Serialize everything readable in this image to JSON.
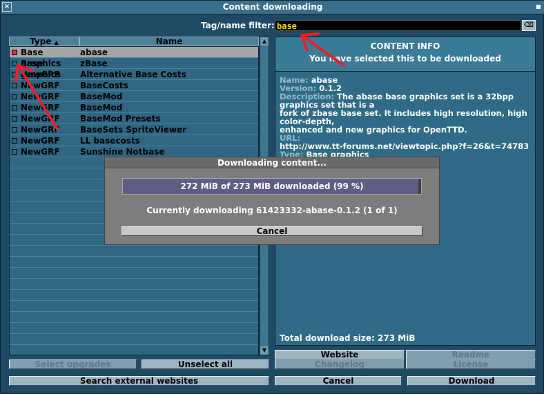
{
  "window": {
    "title": "Content downloading"
  },
  "filter": {
    "label": "Tag/name filter:",
    "value": "base",
    "clear_icon": "⌫"
  },
  "list": {
    "columns": {
      "type": "Type",
      "name": "Name"
    },
    "rows": [
      {
        "type": "Base graphics",
        "name": "abase",
        "checked": true,
        "selected": true
      },
      {
        "type": "Base graphics",
        "name": "zBase",
        "checked": false,
        "selected": false
      },
      {
        "type": "NewGRF",
        "name": "Alternative Base Costs",
        "checked": false,
        "selected": false
      },
      {
        "type": "NewGRF",
        "name": "BaseCosts",
        "checked": false,
        "selected": false
      },
      {
        "type": "NewGRF",
        "name": "BaseMod",
        "checked": false,
        "selected": false
      },
      {
        "type": "NewGRF",
        "name": "BaseMod",
        "checked": false,
        "selected": false
      },
      {
        "type": "NewGRF",
        "name": "BaseMod Presets",
        "checked": false,
        "selected": false
      },
      {
        "type": "NewGRF",
        "name": "BaseSets SpriteViewer",
        "checked": false,
        "selected": false
      },
      {
        "type": "NewGRF",
        "name": "LL basecosts",
        "checked": false,
        "selected": false
      },
      {
        "type": "NewGRF",
        "name": "Sunshine Notbase",
        "checked": false,
        "selected": false
      }
    ]
  },
  "buttons": {
    "select_upgrades": "Select upgrades",
    "unselect_all": "Unselect all",
    "search_external": "Search external websites",
    "website": "Website",
    "readme": "Readme",
    "changelog": "Changelog",
    "license": "License",
    "cancel": "Cancel",
    "download": "Download"
  },
  "info": {
    "heading": "CONTENT INFO",
    "status": "You have selected this to be downloaded",
    "name_key": "Name:",
    "name_val": "abase",
    "version_key": "Version:",
    "version_val": "0.1.2",
    "desc_key": "Description:",
    "desc_line1": "The abase base graphics set is a 32bpp graphics set that is a",
    "desc_line2": "fork of zbase base set. It includes high resolution, high color-depth,",
    "desc_line3": "enhanced and new graphics for OpenTTD.",
    "url_key": "URL:",
    "url_val": "http://www.tt-forums.net/viewtopic.php?f=26&t=74783",
    "type_key": "Type:",
    "type_val": "Base graphics",
    "total": "Total download size: 273 MiB"
  },
  "dialog": {
    "title": "Downloading content...",
    "progress_text": "272 MiB of 273 MiB downloaded (99 %)",
    "progress_fraction": 0.99,
    "status": "Currently downloading 61423332-abase-0.1.2 (1 of 1)",
    "cancel": "Cancel"
  },
  "colors": {
    "annotation_arrow": "#e8202a",
    "checked_box": "#d23a3a"
  }
}
